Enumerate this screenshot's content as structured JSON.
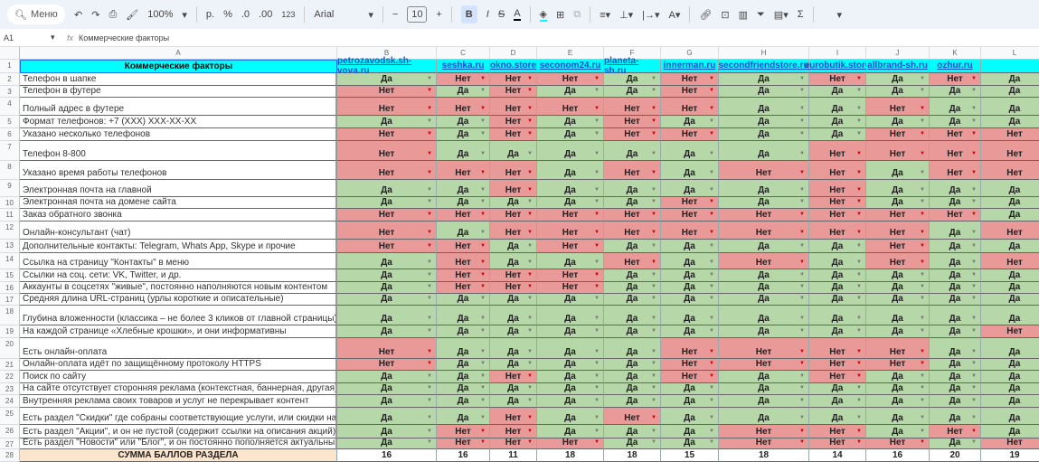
{
  "toolbar": {
    "search": "Меню",
    "zoom": "100%",
    "currency": "р.",
    "percent": "%",
    "dec_less": ".0",
    "dec_more": ".00",
    "format": "123",
    "font": "Arial",
    "font_size": "10",
    "bold": "B",
    "italic": "I",
    "sum": "Σ"
  },
  "formula_bar": {
    "cell_ref": "A1",
    "fx": "fx",
    "value": "Коммерческие факторы"
  },
  "columns": [
    "A",
    "B",
    "C",
    "D",
    "E",
    "F",
    "G",
    "H",
    "I",
    "J",
    "K",
    "L"
  ],
  "title": "Коммерческие факторы",
  "sites": [
    "petrozavodsk.sh-vova.ru",
    "seshka.ru",
    "okno.store",
    "seconom24.ru",
    "planeta-sh.ru",
    "innerman.ru",
    "secondfriendstore.ru",
    "eurobutik.store",
    "allbrand-sh.ru",
    "ozhur.ru",
    ""
  ],
  "rows": [
    {
      "label": "Телефон в шапке",
      "v": [
        "Да",
        "Нет",
        "Нет",
        "Нет",
        "Да",
        "Нет",
        "Да",
        "Нет",
        "Да",
        "Нет",
        "Да"
      ]
    },
    {
      "label": "Телефон в футере",
      "v": [
        "Нет",
        "Да",
        "Нет",
        "Да",
        "Да",
        "Нет",
        "Да",
        "Да",
        "Да",
        "Да",
        "Да"
      ]
    },
    {
      "label": "Полный адрес в футере",
      "v": [
        "Нет",
        "Нет",
        "Нет",
        "Нет",
        "Нет",
        "Нет",
        "Да",
        "Да",
        "Нет",
        "Да",
        "Да"
      ]
    },
    {
      "label": "Формат телефонов: +7 (XXX) XXX-XX-XX",
      "v": [
        "Да",
        "Да",
        "Нет",
        "Да",
        "Нет",
        "Да",
        "Да",
        "Да",
        "Да",
        "Да",
        "Да"
      ]
    },
    {
      "label": "Указано несколько телефонов",
      "v": [
        "Нет",
        "Да",
        "Нет",
        "Да",
        "Нет",
        "Нет",
        "Да",
        "Да",
        "Нет",
        "Нет",
        "Нет"
      ]
    },
    {
      "label": "Телефон 8-800",
      "v": [
        "Нет",
        "Да",
        "Да",
        "Да",
        "Да",
        "Да",
        "Да",
        "Нет",
        "Нет",
        "Нет",
        "Нет"
      ]
    },
    {
      "label": "Указано время работы телефонов",
      "v": [
        "Нет",
        "Нет",
        "Нет",
        "Да",
        "Нет",
        "Да",
        "Нет",
        "Нет",
        "Да",
        "Нет",
        "Нет"
      ]
    },
    {
      "label": "Электронная почта на главной",
      "v": [
        "Да",
        "Да",
        "Нет",
        "Да",
        "Да",
        "Да",
        "Да",
        "Нет",
        "Да",
        "Да",
        "Да"
      ]
    },
    {
      "label": "Электронная почта на домене сайта",
      "v": [
        "Да",
        "Да",
        "Да",
        "Да",
        "Да",
        "Нет",
        "Да",
        "Нет",
        "Да",
        "Да",
        "Да"
      ]
    },
    {
      "label": "Заказ обратного звонка",
      "v": [
        "Нет",
        "Нет",
        "Нет",
        "Нет",
        "Нет",
        "Нет",
        "Нет",
        "Нет",
        "Нет",
        "Нет",
        "Да"
      ]
    },
    {
      "label": "Онлайн-консультант (чат)",
      "v": [
        "Нет",
        "Да",
        "Нет",
        "Нет",
        "Нет",
        "Нет",
        "Нет",
        "Нет",
        "Нет",
        "Да",
        "Нет"
      ]
    },
    {
      "label": "Дополнительные контакты: Telegram, Whats App, Skype и прочие",
      "v": [
        "Нет",
        "Нет",
        "Да",
        "Нет",
        "Да",
        "Да",
        "Да",
        "Да",
        "Нет",
        "Да",
        "Да"
      ]
    },
    {
      "label": "Ссылка на страницу \"Контакты\" в меню",
      "v": [
        "Да",
        "Нет",
        "Да",
        "Да",
        "Нет",
        "Да",
        "Нет",
        "Да",
        "Нет",
        "Да",
        "Нет"
      ]
    },
    {
      "label": "Ссылки на соц. сети: VK, Twitter, и др.",
      "v": [
        "Да",
        "Нет",
        "Нет",
        "Нет",
        "Да",
        "Да",
        "Да",
        "Да",
        "Да",
        "Да",
        "Да"
      ]
    },
    {
      "label": "Аккаунты в соцсетях \"живые\", постоянно наполняются новым контентом",
      "v": [
        "Да",
        "Нет",
        "Нет",
        "Нет",
        "Да",
        "Да",
        "Да",
        "Да",
        "Да",
        "Да",
        "Да"
      ]
    },
    {
      "label": "Средняя длина URL-страниц (урлы короткие и описательные)",
      "v": [
        "Да",
        "Да",
        "Да",
        "Да",
        "Да",
        "Да",
        "Да",
        "Да",
        "Да",
        "Да",
        "Да"
      ]
    },
    {
      "label": "Глубина вложенности (классика – не более 3 кликов от главной страницы)",
      "v": [
        "Да",
        "Да",
        "Да",
        "Да",
        "Да",
        "Да",
        "Да",
        "Да",
        "Да",
        "Да",
        "Да"
      ]
    },
    {
      "label": "На каждой странице «Хлебные крошки», и они информативны",
      "v": [
        "Да",
        "Да",
        "Да",
        "Да",
        "Да",
        "Да",
        "Да",
        "Да",
        "Да",
        "Да",
        "Нет"
      ]
    },
    {
      "label": "Есть онлайн-оплата",
      "v": [
        "Нет",
        "Да",
        "Да",
        "Да",
        "Да",
        "Нет",
        "Нет",
        "Нет",
        "Нет",
        "Да",
        "Да"
      ]
    },
    {
      "label": "Онлайн-оплата идёт по защищённому протоколу HTTPS",
      "v": [
        "Нет",
        "Да",
        "Да",
        "Да",
        "Да",
        "Нет",
        "Нет",
        "Нет",
        "Нет",
        "Да",
        "Да"
      ]
    },
    {
      "label": "Поиск по сайту",
      "v": [
        "Да",
        "Да",
        "Нет",
        "Да",
        "Да",
        "Нет",
        "Да",
        "Нет",
        "Да",
        "Да",
        "Да"
      ]
    },
    {
      "label": "На сайте отсутствует сторонняя реклама (контекстная, баннерная, другая)",
      "v": [
        "Да",
        "Да",
        "Да",
        "Да",
        "Да",
        "Да",
        "Да",
        "Да",
        "Да",
        "Да",
        "Да"
      ]
    },
    {
      "label": "Внутренняя реклама своих товаров и услуг не перекрывает контент",
      "v": [
        "Да",
        "Да",
        "Да",
        "Да",
        "Да",
        "Да",
        "Да",
        "Да",
        "Да",
        "Да",
        "Да"
      ]
    },
    {
      "label": "Есть раздел \"Скидки\" где собраны соответствующие услуги, или скидки на товарах",
      "v": [
        "Да",
        "Да",
        "Нет",
        "Да",
        "Нет",
        "Да",
        "Да",
        "Да",
        "Да",
        "Да",
        "Да"
      ]
    },
    {
      "label": "Есть раздел \"Акции\", и он не пустой (содержит ссылки на описания акций)",
      "v": [
        "Да",
        "Нет",
        "Нет",
        "Да",
        "Да",
        "Да",
        "Нет",
        "Нет",
        "Да",
        "Нет",
        "Да"
      ]
    },
    {
      "label": "Есть раздел \"Новости\" или \"Блог\", и он постоянно пополняется актуальными новостями",
      "v": [
        "Да",
        "Нет",
        "Нет",
        "Нет",
        "Да",
        "Да",
        "Нет",
        "Нет",
        "Нет",
        "Да",
        "Нет"
      ]
    }
  ],
  "sum_label": "СУММА БАЛЛОВ РАЗДЕЛА",
  "sums": [
    "16",
    "16",
    "11",
    "18",
    "18",
    "15",
    "18",
    "14",
    "16",
    "20",
    "19"
  ],
  "colors": {
    "yes": "#b6d7a8",
    "no": "#ea9999",
    "header": "#00ffff",
    "sum": "#fce5cd"
  }
}
